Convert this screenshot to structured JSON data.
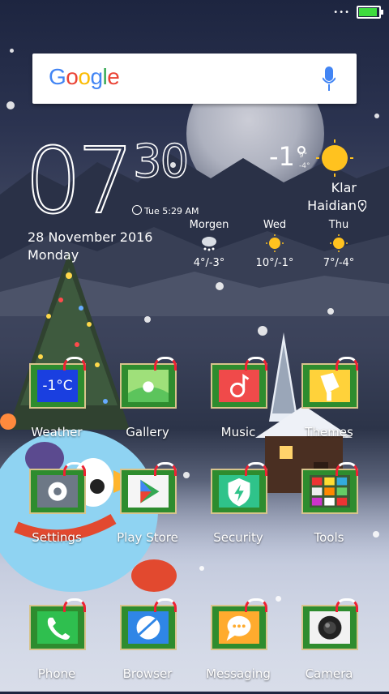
{
  "status_bar": {
    "signal_dots": "•••",
    "battery_level": 1.0,
    "battery_color": "#3fdc3f"
  },
  "search": {
    "logo_text": "Google",
    "mic_icon": "mic-icon"
  },
  "clock": {
    "hours": "07",
    "minutes": "30",
    "alarm": "Tue 5:29 AM",
    "date": "28 November 2016",
    "weekday": "Monday"
  },
  "weather": {
    "current_temp": "-1°",
    "high": "9°",
    "low": "-4°",
    "condition": "Klar",
    "location": "Haidian",
    "forecast": [
      {
        "day": "Morgen",
        "icon": "snow-cloud-icon",
        "temps": "4°/-3°"
      },
      {
        "day": "Wed",
        "icon": "sun-icon",
        "temps": "10°/-1°"
      },
      {
        "day": "Thu",
        "icon": "sun-icon",
        "temps": "7°/-4°"
      }
    ]
  },
  "apps": [
    {
      "label": "Weather",
      "tile_text": "-1°C",
      "icon": "weather-icon"
    },
    {
      "label": "Gallery",
      "icon": "gallery-icon"
    },
    {
      "label": "Music",
      "icon": "music-icon"
    },
    {
      "label": "Themes",
      "icon": "themes-icon"
    },
    {
      "label": "Settings",
      "icon": "gear-icon"
    },
    {
      "label": "Play Store",
      "icon": "play-store-icon"
    },
    {
      "label": "Security",
      "icon": "security-icon"
    },
    {
      "label": "Tools",
      "icon": "tools-icon"
    }
  ],
  "dock": [
    {
      "label": "Phone",
      "icon": "phone-icon"
    },
    {
      "label": "Browser",
      "icon": "browser-icon"
    },
    {
      "label": "Messaging",
      "icon": "messaging-icon"
    },
    {
      "label": "Camera",
      "icon": "camera-icon"
    }
  ]
}
